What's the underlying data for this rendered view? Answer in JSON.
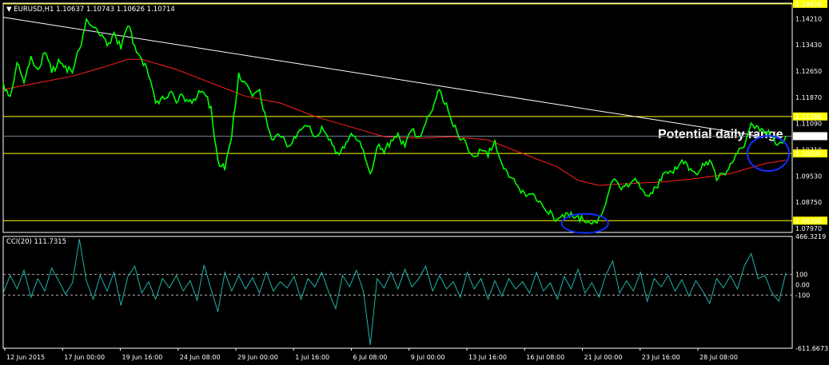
{
  "header": {
    "symbol_label": "EURUSD,H1",
    "ohlc_text": "1.10637 1.10743 1.10626 1.10714"
  },
  "indicator": {
    "label": "CCI(20) 111.7315"
  },
  "annotation": {
    "text": "Potential daily range"
  },
  "chart_data": [
    {
      "type": "line",
      "symbol": "EURUSD",
      "timeframe": "H1",
      "x_tick_labels": [
        "12 Jun 2015",
        "17 Jun 00:00",
        "19 Jun 16:00",
        "24 Jun 08:00",
        "29 Jun 00:00",
        "1 Jul 16:00",
        "6 Jul 08:00",
        "9 Jul 00:00",
        "13 Jul 16:00",
        "16 Jul 08:00",
        "21 Jul 00:00",
        "23 Jul 16:00",
        "28 Jul 08:00"
      ],
      "y_tick_labels": [
        "1.14650",
        "1.14210",
        "1.13430",
        "1.12650",
        "1.11870",
        "1.11300",
        "1.11090",
        "1.10714",
        "1.10310",
        "1.10200",
        "1.09530",
        "1.08750",
        "1.08200",
        "1.07970"
      ],
      "ylim": [
        1.0785,
        1.1467
      ],
      "current_price": 1.10714,
      "colors": {
        "price": "#00ff00",
        "ma": "#ff2020",
        "trendline": "#ffffff",
        "hlines": "#ffff00",
        "circles": "#1030ff",
        "cci": "#20b2aa",
        "current_marker": "#ffffff"
      },
      "horizontal_lines": [
        1.1465,
        1.113,
        1.102,
        1.082
      ],
      "trendline": [
        [
          0,
          1.1425
        ],
        [
          1.0,
          1.1072
        ]
      ],
      "price_series": [
        [
          0.0,
          1.123
        ],
        [
          0.01,
          1.119
        ],
        [
          0.02,
          1.129
        ],
        [
          0.03,
          1.123
        ],
        [
          0.04,
          1.131
        ],
        [
          0.05,
          1.127
        ],
        [
          0.06,
          1.132
        ],
        [
          0.07,
          1.126
        ],
        [
          0.08,
          1.13
        ],
        [
          0.09,
          1.128
        ],
        [
          0.1,
          1.126
        ],
        [
          0.11,
          1.133
        ],
        [
          0.12,
          1.142
        ],
        [
          0.13,
          1.1395
        ],
        [
          0.14,
          1.137
        ],
        [
          0.15,
          1.134
        ],
        [
          0.16,
          1.138
        ],
        [
          0.17,
          1.133
        ],
        [
          0.18,
          1.1398
        ],
        [
          0.19,
          1.134
        ],
        [
          0.2,
          1.13
        ],
        [
          0.21,
          1.125
        ],
        [
          0.22,
          1.117
        ],
        [
          0.23,
          1.119
        ],
        [
          0.24,
          1.12
        ],
        [
          0.25,
          1.117
        ],
        [
          0.26,
          1.119
        ],
        [
          0.27,
          1.118
        ],
        [
          0.28,
          1.119
        ],
        [
          0.29,
          1.12
        ],
        [
          0.3,
          1.116
        ],
        [
          0.31,
          1.1
        ],
        [
          0.32,
          1.097
        ],
        [
          0.33,
          1.107
        ],
        [
          0.34,
          1.126
        ],
        [
          0.35,
          1.123
        ],
        [
          0.36,
          1.119
        ],
        [
          0.37,
          1.121
        ],
        [
          0.38,
          1.112
        ],
        [
          0.39,
          1.106
        ],
        [
          0.4,
          1.107
        ],
        [
          0.41,
          1.104
        ],
        [
          0.42,
          1.107
        ],
        [
          0.43,
          1.109
        ],
        [
          0.44,
          1.11
        ],
        [
          0.45,
          1.107
        ],
        [
          0.46,
          1.11
        ],
        [
          0.47,
          1.106
        ],
        [
          0.48,
          1.102
        ],
        [
          0.49,
          1.104
        ],
        [
          0.5,
          1.107
        ],
        [
          0.51,
          1.106
        ],
        [
          0.52,
          1.103
        ],
        [
          0.53,
          1.096
        ],
        [
          0.54,
          1.104
        ],
        [
          0.55,
          1.102
        ],
        [
          0.56,
          1.106
        ],
        [
          0.57,
          1.108
        ],
        [
          0.58,
          1.104
        ],
        [
          0.59,
          1.109
        ],
        [
          0.6,
          1.107
        ],
        [
          0.61,
          1.111
        ],
        [
          0.62,
          1.115
        ],
        [
          0.63,
          1.121
        ],
        [
          0.64,
          1.117
        ],
        [
          0.65,
          1.11
        ],
        [
          0.66,
          1.106
        ],
        [
          0.67,
          1.104
        ],
        [
          0.68,
          1.101
        ],
        [
          0.69,
          1.103
        ],
        [
          0.7,
          1.101
        ],
        [
          0.71,
          1.106
        ],
        [
          0.72,
          1.099
        ],
        [
          0.73,
          1.095
        ],
        [
          0.74,
          1.093
        ],
        [
          0.75,
          1.091
        ],
        [
          0.76,
          1.09
        ],
        [
          0.77,
          1.088
        ],
        [
          0.78,
          1.086
        ],
        [
          0.79,
          1.085
        ],
        [
          0.8,
          1.0825
        ],
        [
          0.81,
          1.083
        ],
        [
          0.82,
          1.0845
        ],
        [
          0.83,
          1.0835
        ],
        [
          0.84,
          1.0815
        ],
        [
          0.85,
          1.081
        ],
        [
          0.86,
          1.083
        ],
        [
          0.87,
          1.087
        ],
        [
          0.88,
          1.094
        ],
        [
          0.89,
          1.092
        ],
        [
          0.9,
          1.093
        ],
        [
          0.91,
          1.094
        ],
        [
          0.92,
          1.0915
        ],
        [
          0.93,
          1.0895
        ],
        [
          0.94,
          1.092
        ],
        [
          0.95,
          1.094
        ],
        [
          0.96,
          1.096
        ],
        [
          0.97,
          1.098
        ],
        [
          0.98,
          1.1
        ],
        [
          0.99,
          1.097
        ],
        [
          1.0,
          1.096
        ],
        [
          1.01,
          1.099
        ],
        [
          1.02,
          1.1
        ],
        [
          1.03,
          1.094
        ],
        [
          1.04,
          1.096
        ],
        [
          1.05,
          1.099
        ],
        [
          1.06,
          1.102
        ],
        [
          1.07,
          1.104
        ],
        [
          1.08,
          1.111
        ],
        [
          1.09,
          1.11
        ],
        [
          1.1,
          1.108
        ],
        [
          1.11,
          1.107
        ],
        [
          1.12,
          1.105
        ],
        [
          1.13,
          1.1071
        ]
      ],
      "ma_series": [
        [
          0.0,
          1.121
        ],
        [
          0.05,
          1.123
        ],
        [
          0.1,
          1.125
        ],
        [
          0.15,
          1.128
        ],
        [
          0.18,
          1.13
        ],
        [
          0.2,
          1.13
        ],
        [
          0.25,
          1.127
        ],
        [
          0.3,
          1.123
        ],
        [
          0.35,
          1.119
        ],
        [
          0.4,
          1.117
        ],
        [
          0.45,
          1.113
        ],
        [
          0.5,
          1.11
        ],
        [
          0.55,
          1.107
        ],
        [
          0.6,
          1.1065
        ],
        [
          0.65,
          1.107
        ],
        [
          0.7,
          1.106
        ],
        [
          0.75,
          1.102
        ],
        [
          0.8,
          1.098
        ],
        [
          0.83,
          1.094
        ],
        [
          0.86,
          1.0925
        ],
        [
          0.9,
          1.093
        ],
        [
          0.95,
          1.0935
        ],
        [
          1.0,
          1.0945
        ],
        [
          1.05,
          1.096
        ],
        [
          1.1,
          1.099
        ],
        [
          1.13,
          1.1
        ]
      ],
      "ellipses": [
        {
          "center": [
            0.84,
            1.0812
          ],
          "label": "low"
        },
        {
          "center": [
            1.1,
            1.102
          ],
          "label": "current"
        }
      ]
    },
    {
      "type": "line",
      "name": "CCI(20)",
      "last_value": 111.7315,
      "y_tick_labels": [
        "466.3219",
        "100",
        "0.00",
        "-100",
        "-611.6673"
      ],
      "ylim": [
        -611.6673,
        466.3219
      ],
      "levels": [
        100,
        -100
      ],
      "cci_series": [
        [
          0.0,
          -80
        ],
        [
          0.01,
          90
        ],
        [
          0.02,
          -40
        ],
        [
          0.03,
          140
        ],
        [
          0.04,
          -120
        ],
        [
          0.05,
          60
        ],
        [
          0.06,
          -60
        ],
        [
          0.07,
          160
        ],
        [
          0.08,
          40
        ],
        [
          0.09,
          -90
        ],
        [
          0.1,
          20
        ],
        [
          0.11,
          440
        ],
        [
          0.12,
          40
        ],
        [
          0.13,
          -140
        ],
        [
          0.14,
          90
        ],
        [
          0.15,
          -60
        ],
        [
          0.16,
          120
        ],
        [
          0.17,
          -200
        ],
        [
          0.18,
          80
        ],
        [
          0.19,
          180
        ],
        [
          0.2,
          -80
        ],
        [
          0.21,
          30
        ],
        [
          0.22,
          -140
        ],
        [
          0.23,
          60
        ],
        [
          0.24,
          -30
        ],
        [
          0.25,
          90
        ],
        [
          0.26,
          -60
        ],
        [
          0.27,
          40
        ],
        [
          0.28,
          -150
        ],
        [
          0.29,
          190
        ],
        [
          0.3,
          -40
        ],
        [
          0.31,
          -260
        ],
        [
          0.32,
          120
        ],
        [
          0.33,
          -60
        ],
        [
          0.34,
          90
        ],
        [
          0.35,
          -40
        ],
        [
          0.36,
          70
        ],
        [
          0.37,
          -80
        ],
        [
          0.38,
          120
        ],
        [
          0.39,
          -60
        ],
        [
          0.4,
          30
        ],
        [
          0.41,
          -30
        ],
        [
          0.42,
          80
        ],
        [
          0.43,
          -140
        ],
        [
          0.44,
          60
        ],
        [
          0.45,
          -20
        ],
        [
          0.46,
          120
        ],
        [
          0.47,
          -70
        ],
        [
          0.48,
          -230
        ],
        [
          0.49,
          90
        ],
        [
          0.5,
          -20
        ],
        [
          0.51,
          140
        ],
        [
          0.52,
          -60
        ],
        [
          0.53,
          -580
        ],
        [
          0.54,
          60
        ],
        [
          0.55,
          -30
        ],
        [
          0.56,
          120
        ],
        [
          0.57,
          -40
        ],
        [
          0.58,
          150
        ],
        [
          0.59,
          -20
        ],
        [
          0.6,
          60
        ],
        [
          0.61,
          180
        ],
        [
          0.62,
          -60
        ],
        [
          0.63,
          90
        ],
        [
          0.64,
          -40
        ],
        [
          0.65,
          30
        ],
        [
          0.66,
          -120
        ],
        [
          0.67,
          120
        ],
        [
          0.68,
          -40
        ],
        [
          0.69,
          60
        ],
        [
          0.7,
          -140
        ],
        [
          0.71,
          40
        ],
        [
          0.72,
          -110
        ],
        [
          0.73,
          60
        ],
        [
          0.74,
          -40
        ],
        [
          0.75,
          30
        ],
        [
          0.76,
          -80
        ],
        [
          0.77,
          120
        ],
        [
          0.78,
          -60
        ],
        [
          0.79,
          20
        ],
        [
          0.8,
          -140
        ],
        [
          0.81,
          80
        ],
        [
          0.82,
          -40
        ],
        [
          0.83,
          150
        ],
        [
          0.84,
          -80
        ],
        [
          0.85,
          20
        ],
        [
          0.86,
          -120
        ],
        [
          0.87,
          90
        ],
        [
          0.88,
          230
        ],
        [
          0.89,
          -80
        ],
        [
          0.9,
          40
        ],
        [
          0.91,
          -60
        ],
        [
          0.92,
          120
        ],
        [
          0.93,
          -160
        ],
        [
          0.94,
          60
        ],
        [
          0.95,
          -20
        ],
        [
          0.96,
          90
        ],
        [
          0.97,
          -60
        ],
        [
          0.98,
          50
        ],
        [
          0.99,
          -110
        ],
        [
          1.0,
          40
        ],
        [
          1.01,
          -60
        ],
        [
          1.02,
          -180
        ],
        [
          1.03,
          60
        ],
        [
          1.04,
          -30
        ],
        [
          1.05,
          90
        ],
        [
          1.06,
          -40
        ],
        [
          1.07,
          180
        ],
        [
          1.08,
          300
        ],
        [
          1.09,
          60
        ],
        [
          1.1,
          90
        ],
        [
          1.11,
          -80
        ],
        [
          1.12,
          -160
        ],
        [
          1.13,
          112
        ]
      ]
    }
  ]
}
